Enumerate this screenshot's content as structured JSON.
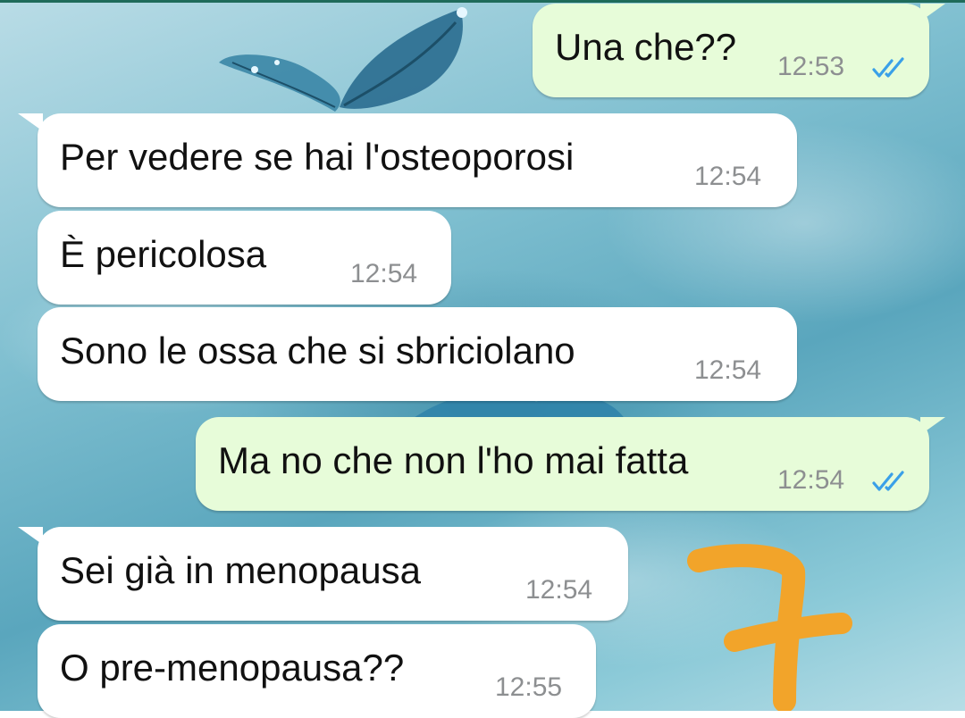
{
  "chat": {
    "messages": [
      {
        "direction": "outgoing",
        "text": "Una che??",
        "time": "12:53",
        "status": "read"
      },
      {
        "direction": "incoming",
        "text": "Per vedere se hai l'osteoporosi",
        "time": "12:54"
      },
      {
        "direction": "incoming",
        "text": "È pericolosa",
        "time": "12:54"
      },
      {
        "direction": "incoming",
        "text": "Sono le ossa che si sbriciolano",
        "time": "12:54"
      },
      {
        "direction": "outgoing",
        "text": "Ma no che non l'ho mai fatta",
        "time": "12:54",
        "status": "read"
      },
      {
        "direction": "incoming",
        "text": "Sei già in menopausa",
        "time": "12:54"
      },
      {
        "direction": "incoming",
        "text": "O pre-menopausa??",
        "time": "12:55"
      }
    ]
  },
  "colors": {
    "incoming_bubble": "#ffffff",
    "outgoing_bubble": "#e7fcd9",
    "read_ticks": "#3aa0e8",
    "timestamp": "#8d8f91",
    "annotation": "#f2a42a"
  },
  "icons": {
    "read_receipt": "double-check-icon",
    "wallpaper_decoration": "butterfly-icon",
    "annotation": "hand-drawn-seven-mark"
  }
}
